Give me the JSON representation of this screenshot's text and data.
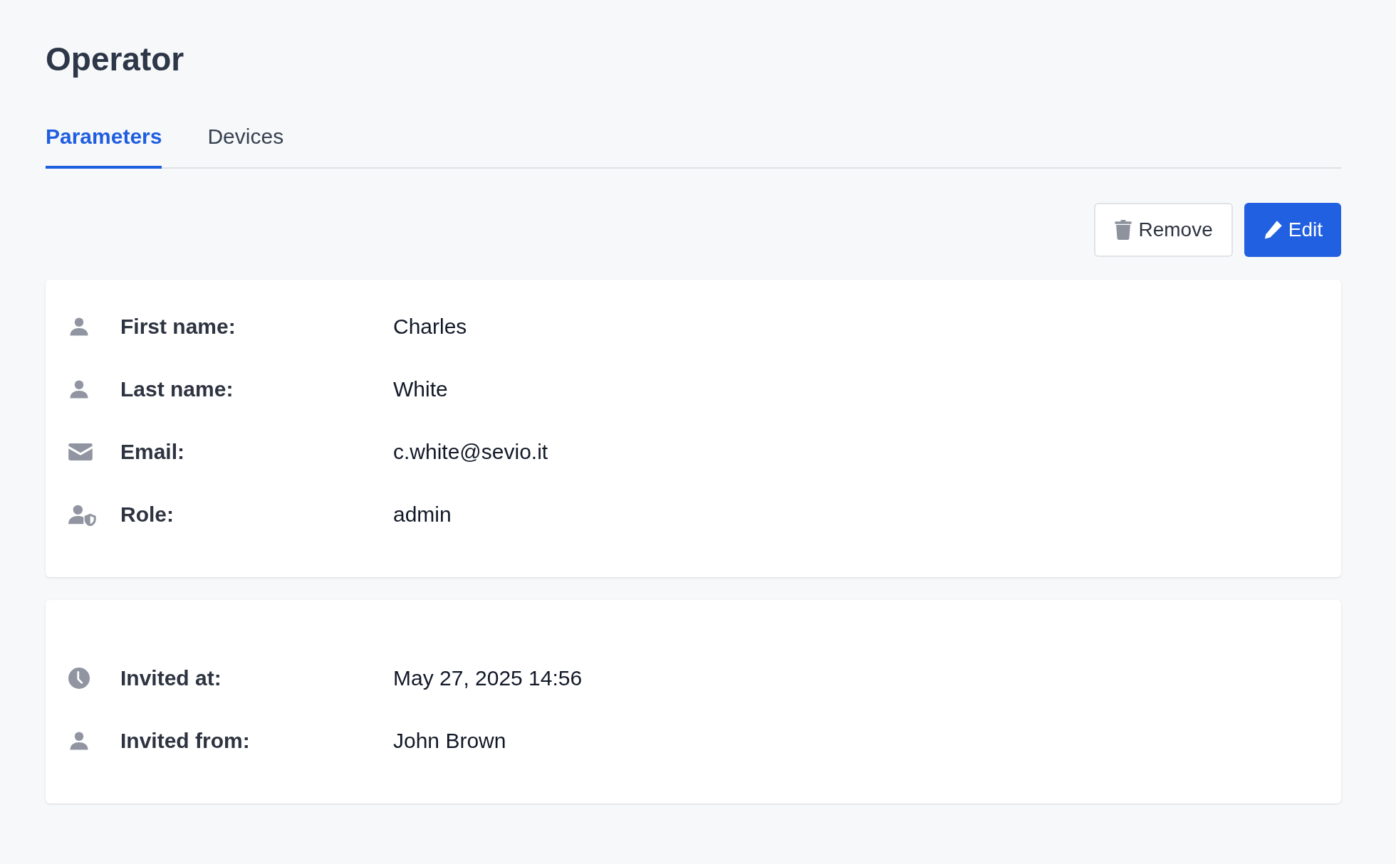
{
  "page": {
    "title": "Operator"
  },
  "tabs": [
    {
      "label": "Parameters",
      "selected": true
    },
    {
      "label": "Devices",
      "selected": false
    }
  ],
  "actions": [
    {
      "kind": "remove",
      "label": "Remove"
    },
    {
      "kind": "edit",
      "label": "Edit"
    }
  ],
  "cards": [
    {
      "rows": [
        {
          "kind": "person",
          "label": "First name:",
          "value": "Charles"
        },
        {
          "kind": "person",
          "label": "Last name:",
          "value": "White"
        },
        {
          "kind": "email",
          "label": "Email:",
          "value": "c.white@sevio.it"
        },
        {
          "kind": "role",
          "label": "Role:",
          "value": "admin"
        }
      ]
    },
    {
      "rows": [
        {
          "kind": "time",
          "label": "Invited at:",
          "value": "May 27, 2025 14:56"
        },
        {
          "kind": "person",
          "label": "Invited from:",
          "value": "John Brown"
        }
      ]
    }
  ]
}
